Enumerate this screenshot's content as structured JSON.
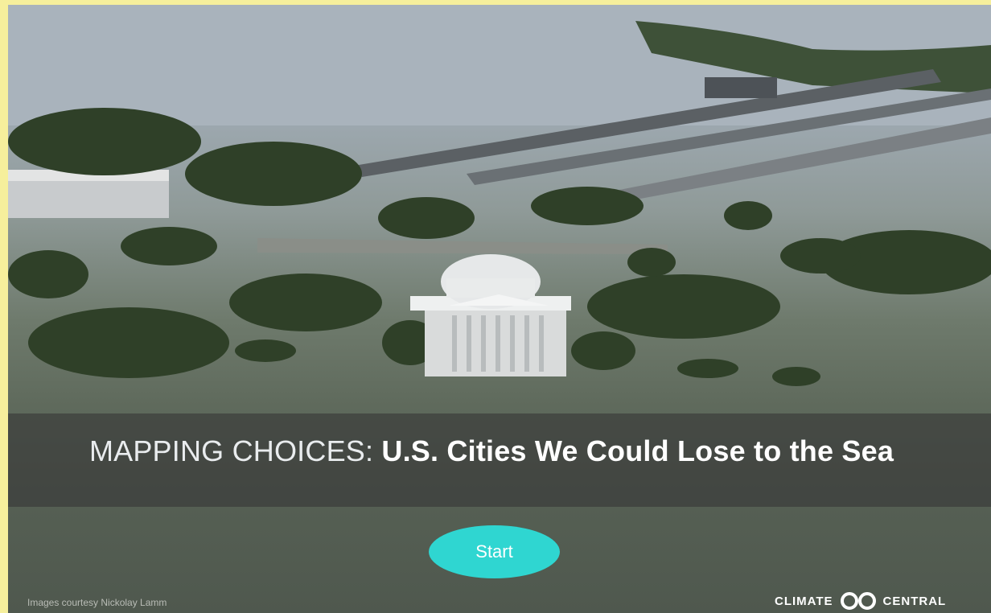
{
  "hero": {
    "title_lead": "MAPPING CHOICES:",
    "title_main": "U.S. Cities We Could Lose to the Sea",
    "image_alt": "Flooded Jefferson Memorial with surrounding trees and bridges submerged"
  },
  "actions": {
    "start_label": "Start"
  },
  "footer": {
    "credit": "Images courtesy Nickolay Lamm",
    "brand_left": "CLIMATE",
    "brand_right": "CENTRAL",
    "brand_icon": "climate-central-logo-icon"
  },
  "colors": {
    "page_border": "#f6ef9c",
    "accent_button": "#2fd6d1",
    "banner": "#373737"
  }
}
